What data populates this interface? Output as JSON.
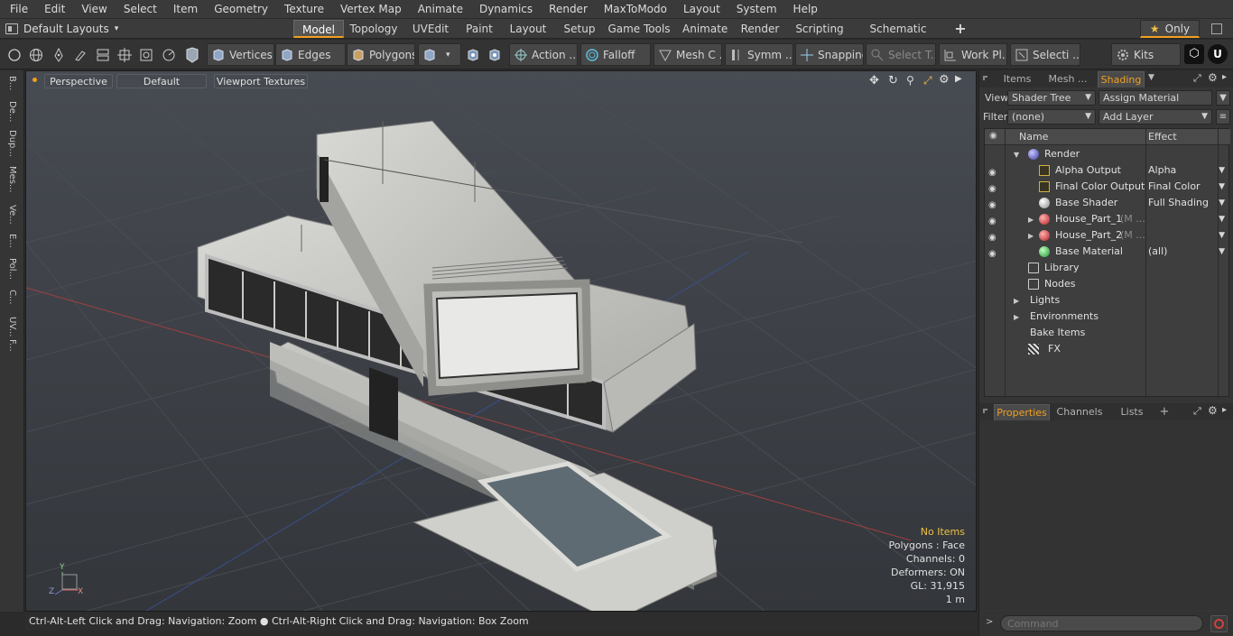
{
  "menu": [
    "File",
    "Edit",
    "View",
    "Select",
    "Item",
    "Geometry",
    "Texture",
    "Vertex Map",
    "Animate",
    "Dynamics",
    "Render",
    "MaxToModo",
    "Layout",
    "System",
    "Help"
  ],
  "layouts": {
    "label": "Default Layouts",
    "arrow": "▾"
  },
  "tabs": [
    "Model",
    "Topology",
    "UVEdit",
    "Paint",
    "Layout",
    "Setup",
    "Game Tools",
    "Animate",
    "Render",
    "Scripting",
    "Schematic Fusion"
  ],
  "tabs_add": "+",
  "only_label": "Only",
  "toolbar": {
    "vertices": "Vertices",
    "edges": "Edges",
    "polygons": "Polygons",
    "action": "Action ...",
    "falloff": "Falloff",
    "mesh": "Mesh C ...",
    "symm": "Symm ...",
    "snapping": "Snapping",
    "select_t": "Select T...",
    "workpl": "Work Pl...",
    "selecti": "Selecti ...",
    "kits": "Kits"
  },
  "left_strip": [
    "B...",
    "De...",
    "Dup...",
    "Mes...",
    "Ve...",
    "E...",
    "Pol...",
    "C...",
    "UV...",
    "F..."
  ],
  "viewport": {
    "perspective": "Perspective",
    "default": "Default",
    "textures": "Viewport Textures",
    "info_no_items": "No Items",
    "info_polygons": "Polygons : Face",
    "info_channels": "Channels: 0",
    "info_deformers": "Deformers: ON",
    "info_gl": "GL: 31,915",
    "info_scale": "1 m",
    "axis_y": "Y",
    "axis_z": "Z",
    "axis_x": "X"
  },
  "status": "Ctrl-Alt-Left Click and Drag: Navigation: Zoom ● Ctrl-Alt-Right Click and Drag: Navigation: Box Zoom",
  "right": {
    "tabs": [
      "Items",
      "Mesh ...",
      "Shading"
    ],
    "view_label": "View",
    "view_value": "Shader Tree",
    "assign": "Assign Material",
    "filter_label": "Filter",
    "filter_value": "(none)",
    "add_layer": "Add Layer",
    "col_name": "Name",
    "col_effect": "Effect",
    "rows": [
      {
        "name": "Render",
        "effect": ""
      },
      {
        "name": "Alpha Output",
        "effect": "Alpha"
      },
      {
        "name": "Final Color Output",
        "effect": "Final Color"
      },
      {
        "name": "Base Shader",
        "effect": "Full Shading"
      },
      {
        "name": "House_Part_1",
        "suffix": "(M ...",
        "effect": ""
      },
      {
        "name": "House_Part_2",
        "suffix": "(M ...",
        "effect": ""
      },
      {
        "name": "Base Material",
        "effect": "(all)"
      },
      {
        "name": "Library",
        "effect": ""
      },
      {
        "name": "Nodes",
        "effect": ""
      },
      {
        "name": "Lights",
        "effect": ""
      },
      {
        "name": "Environments",
        "effect": ""
      },
      {
        "name": "Bake Items",
        "effect": ""
      },
      {
        "name": "FX",
        "effect": ""
      }
    ],
    "bottom_tabs": [
      "Properties",
      "Channels",
      "Lists"
    ],
    "bottom_add": "+",
    "command_placeholder": "Command"
  },
  "colors": {
    "accent": "#f0a020",
    "viewport_bg": "#3d4147",
    "panel": "#353535"
  }
}
